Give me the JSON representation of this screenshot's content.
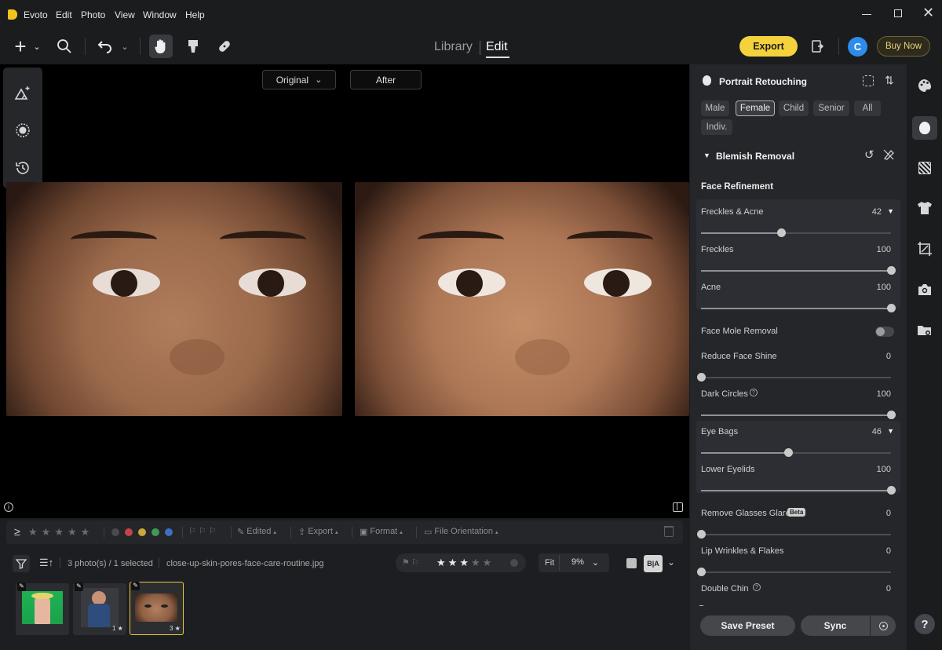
{
  "app": {
    "name": "Evoto"
  },
  "menu": [
    "Edit",
    "Photo",
    "View",
    "Window",
    "Help"
  ],
  "window_controls": [
    "minimize",
    "maximize",
    "close"
  ],
  "modes": {
    "library": "Library",
    "edit": "Edit"
  },
  "header": {
    "export_label": "Export",
    "avatar_letter": "C",
    "buy_label": "Buy Now"
  },
  "compare": {
    "original_label": "Original",
    "after_label": "After"
  },
  "panel": {
    "title": "Portrait Retouching",
    "chips": [
      "Male",
      "Female",
      "Child",
      "Senior",
      "All",
      "Indiv."
    ],
    "selected_chip": "Female",
    "section_title": "Blemish Removal",
    "subsection": "Face Refinement",
    "sliders": [
      {
        "label": "Freckles & Acne",
        "value": "42",
        "fraction": 0.42,
        "dropdown": true
      },
      {
        "label": "Freckles",
        "value": "100",
        "fraction": 1.0
      },
      {
        "label": "Acne",
        "value": "100",
        "fraction": 1.0
      },
      {
        "label": "Reduce Face Shine",
        "value": "0",
        "fraction": 0.0
      },
      {
        "label": "Dark Circles",
        "value": "100",
        "fraction": 1.0,
        "info": true
      },
      {
        "label": "Eye Bags",
        "value": "46",
        "fraction": 0.46,
        "dropdown": true
      },
      {
        "label": "Lower Eyelids",
        "value": "100",
        "fraction": 1.0
      },
      {
        "label": "Remove Glasses Glare",
        "value": "0",
        "fraction": 0.0,
        "badge": "Beta"
      },
      {
        "label": "Lip Wrinkles & Flakes",
        "value": "0",
        "fraction": 0.0
      },
      {
        "label": "Double Chin",
        "value": "0",
        "fraction": 0.0,
        "info": true
      }
    ],
    "toggle": {
      "label": "Face Mole Removal",
      "on": false
    },
    "save_preset_label": "Save Preset",
    "sync_label": "Sync"
  },
  "filterbar": {
    "edited_label": "Edited",
    "export_label": "Export",
    "format_label": "Format",
    "orientation_label": "File Orientation",
    "color_dots": [
      "#4a4a4d",
      "#c0454a",
      "#c9a93a",
      "#3f9a5a",
      "#3f6fc0"
    ]
  },
  "filmstrip_bar": {
    "count_label": "3 photo(s) / 1 selected",
    "filename": "close-up-skin-pores-face-care-routine.jpg",
    "fit_label": "Fit",
    "zoom_label": "9%",
    "rating": 3,
    "ba_label": "B|A"
  },
  "thumbnails": [
    {
      "name": "thumb-1",
      "rating": ""
    },
    {
      "name": "thumb-2",
      "rating": "1 ★"
    },
    {
      "name": "thumb-3",
      "rating": "3 ★"
    }
  ],
  "help_label": "?",
  "colors": {
    "accent_yellow": "#f4d23c",
    "avatar_blue": "#2f8be8",
    "panel_bg": "#25262a"
  }
}
